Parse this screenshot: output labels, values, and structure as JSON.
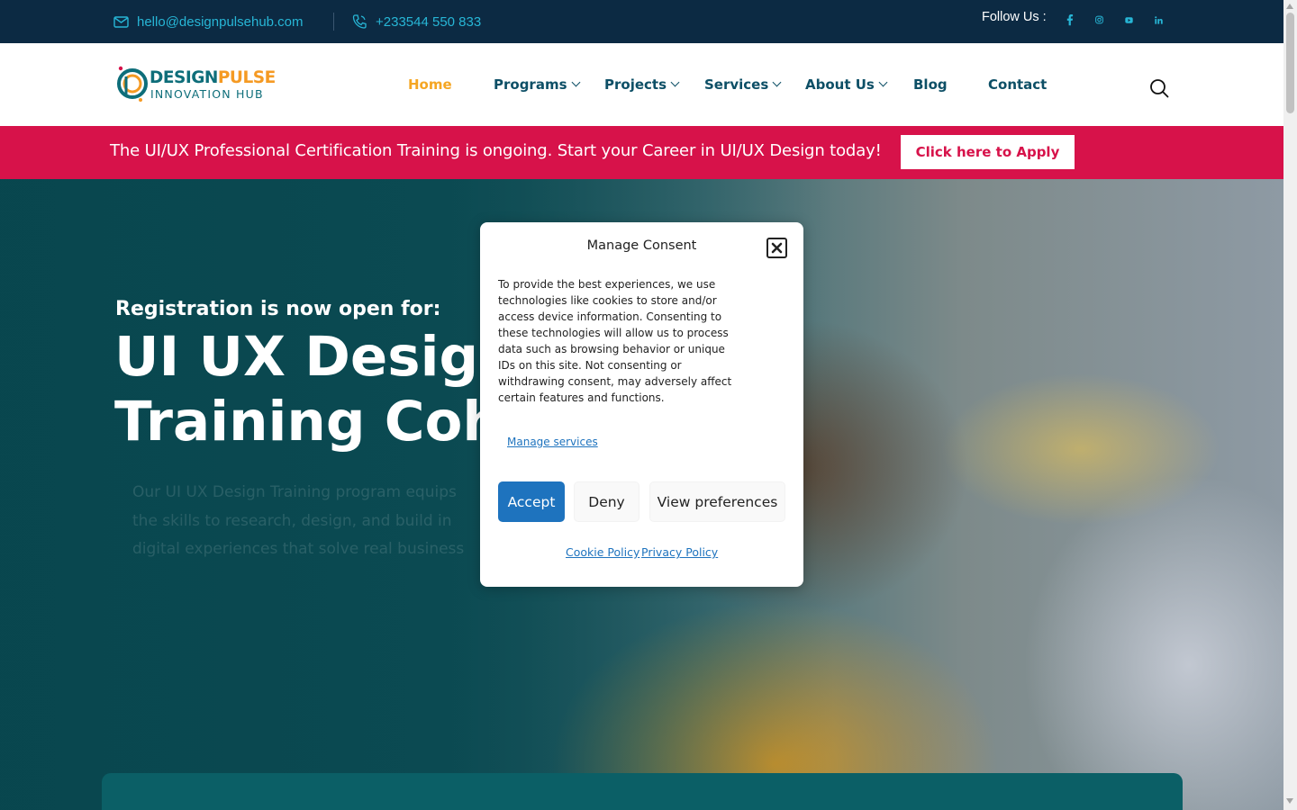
{
  "topbar": {
    "email": "hello@designpulsehub.com",
    "phone": "+233544 550 833",
    "follow_label": "Follow Us :",
    "social_icons": [
      "facebook-icon",
      "instagram-icon",
      "youtube-icon",
      "linkedin-icon"
    ]
  },
  "header": {
    "logo_text_primary_a": "DESIGN",
    "logo_text_primary_b": "PULSE",
    "logo_text_secondary": "INNOVATION HUB",
    "nav": {
      "home": "Home",
      "programs": "Programs",
      "projects": "Projects",
      "services": "Services",
      "about": "About Us",
      "blog": "Blog",
      "contact": "Contact"
    },
    "active_nav": "home"
  },
  "banner": {
    "text": "The UI/UX Professional Certification Training is ongoing. Start your Career in UI/UX Design today!",
    "button": "Click here to Apply"
  },
  "hero": {
    "kicker": "Registration is now open for:",
    "title_line1": "UI UX Design",
    "title_line2": "Training Coh",
    "desc_line1": "Our UI UX Design Training program equips",
    "desc_line2": "the skills to research, design, and build in",
    "desc_line3": "digital experiences that solve real business"
  },
  "consent": {
    "title": "Manage Consent",
    "body": "To provide the best experiences, we use technologies like cookies to store and/or access device information. Consenting to these technologies will allow us to process data such as browsing behavior or unique IDs on this site. Not consenting or withdrawing consent, may adversely affect certain features and functions.",
    "manage_services": "Manage services",
    "accept": "Accept",
    "deny": "Deny",
    "view_preferences": "View preferences",
    "cookie_policy": "Cookie Policy",
    "privacy_policy": "Privacy Policy"
  },
  "colors": {
    "topbar_bg": "#0c2a43",
    "accent_cyan": "#27b6d6",
    "nav_text": "#0d4f66",
    "nav_active": "#f5a623",
    "banner_bg": "#d7124a",
    "consent_blue": "#1e73be",
    "hero_teal": "#0b5f66"
  }
}
